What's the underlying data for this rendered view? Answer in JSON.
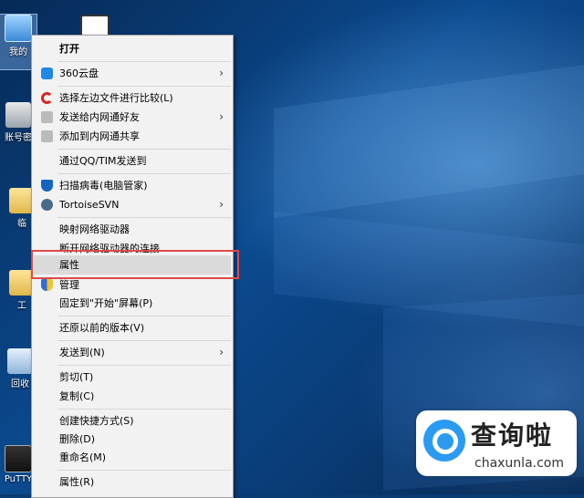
{
  "desktop": {
    "icons": [
      {
        "label": "我的",
        "glyph": "computer-icon"
      },
      {
        "label": "",
        "glyph": "file-icon"
      },
      {
        "label": "账号密",
        "glyph": "user-account-icon"
      },
      {
        "label": "临",
        "glyph": "folder-icon"
      },
      {
        "label": "工",
        "glyph": "folder-icon"
      },
      {
        "label": "回收",
        "glyph": "recycle-bin-icon"
      },
      {
        "label": "PuTTY",
        "glyph": "putty-icon"
      }
    ]
  },
  "context_menu": {
    "items": [
      {
        "label": "打开",
        "bold": true
      },
      {
        "label": "360云盘",
        "icon": "cloud-icon",
        "submenu": true
      },
      {
        "label": "选择左边文件进行比较(L)",
        "icon": "compare-arrow-icon"
      },
      {
        "label": "发送给内网通好友",
        "icon": "share-icon",
        "submenu": true
      },
      {
        "label": "添加到内网通共享",
        "icon": "share-icon"
      },
      {
        "label": "通过QQ/TIM发送到"
      },
      {
        "label": "扫描病毒(电脑管家)",
        "icon": "shield-scan-icon"
      },
      {
        "label": "TortoiseSVN",
        "icon": "tortoise-icon",
        "submenu": true
      },
      {
        "label": "映射网络驱动器"
      },
      {
        "label": "断开网络驱动器的连接"
      },
      {
        "label": "属性"
      },
      {
        "label": "管理",
        "icon": "uac-shield-icon"
      },
      {
        "label": "固定到\"开始\"屏幕(P)"
      },
      {
        "label": "还原以前的版本(V)"
      },
      {
        "label": "发送到(N)",
        "submenu": true
      },
      {
        "label": "剪切(T)"
      },
      {
        "label": "复制(C)"
      },
      {
        "label": "创建快捷方式(S)"
      },
      {
        "label": "删除(D)"
      },
      {
        "label": "重命名(M)"
      },
      {
        "label": "属性(R)"
      }
    ],
    "submenu_arrow": "›"
  },
  "watermark": {
    "title": "查询啦",
    "url": "chaxunla.com"
  },
  "colors": {
    "highlight_border": "#e04848",
    "hover_bg": "#dadada",
    "accent_blue": "#2a9bf0"
  }
}
